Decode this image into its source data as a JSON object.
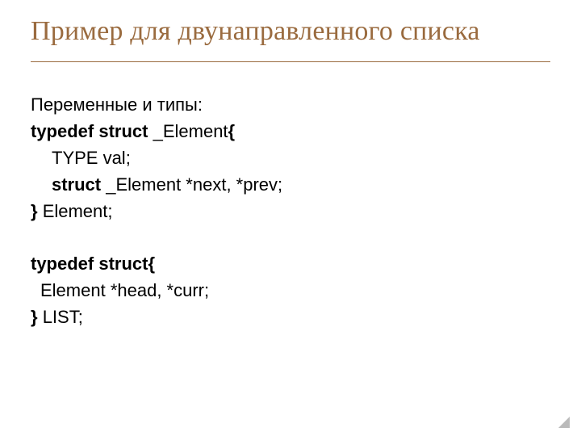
{
  "slide": {
    "title": "Пример для двунаправленного списка",
    "intro": "Переменные и типы:",
    "block1": {
      "line1_kw": "typedef struct ",
      "line1_id": "_Element",
      "line1_brace": "{",
      "line2": "TYPE val;",
      "line3_kw": "struct ",
      "line3_rest": "_Element *next, *prev;",
      "line4_brace": "} ",
      "line4_rest": "Element;"
    },
    "block2": {
      "line1_kw": "typedef struct",
      "line1_brace": "{",
      "line2": "Element *head, *curr;",
      "line3_brace": "} ",
      "line3_rest": "LIST;"
    }
  }
}
